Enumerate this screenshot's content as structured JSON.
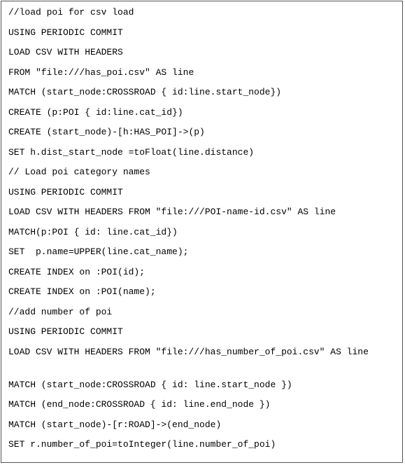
{
  "code_lines": [
    "//load poi for csv load",
    "USING PERIODIC COMMIT",
    "LOAD CSV WITH HEADERS",
    "FROM \"file:///has_poi.csv\" AS line",
    "MATCH (start_node:CROSSROAD { id:line.start_node})",
    "CREATE (p:POI { id:line.cat_id})",
    "CREATE (start_node)-[h:HAS_POI]->(p)",
    "SET h.dist_start_node =toFloat(line.distance)",
    "// Load poi category names",
    "USING PERIODIC COMMIT",
    "LOAD CSV WITH HEADERS FROM \"file:///POI-name-id.csv\" AS line",
    "MATCH(p:POI { id: line.cat_id})",
    "SET  p.name=UPPER(line.cat_name);",
    "CREATE INDEX on :POI(id);",
    "CREATE INDEX on :POI(name);",
    "//add number of poi",
    "USING PERIODIC COMMIT",
    "LOAD CSV WITH HEADERS FROM \"file:///has_number_of_poi.csv\" AS line",
    "MATCH (start_node:CROSSROAD { id: line.start_node })",
    "MATCH (end_node:CROSSROAD { id: line.end_node })",
    "MATCH (start_node)-[r:ROAD]->(end_node)",
    "SET r.number_of_poi=toInteger(line.number_of_poi)"
  ]
}
